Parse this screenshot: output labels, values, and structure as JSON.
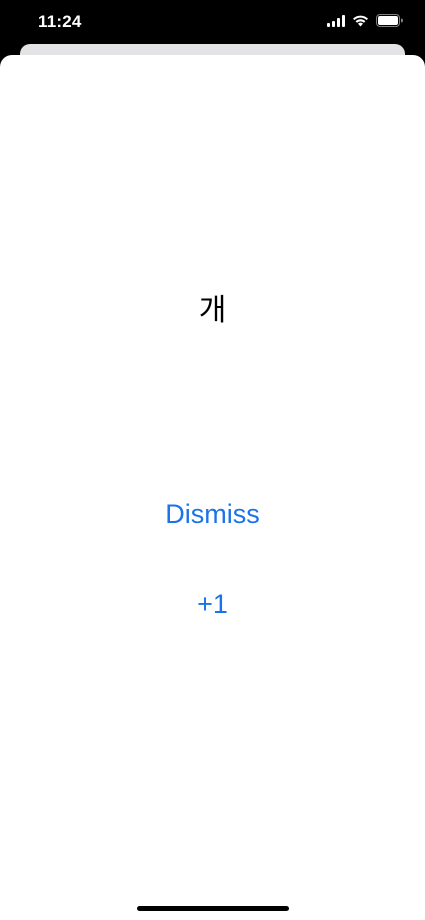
{
  "status_bar": {
    "time": "11:24",
    "icons": [
      "cellular-signal-icon",
      "wifi-icon",
      "battery-icon"
    ]
  },
  "sheet": {
    "word": "개",
    "dismiss_label": "Dismiss",
    "plus_one_label": "+1"
  },
  "colors": {
    "accent": "#1a73e8",
    "text": "#000000",
    "sheet_background": "#ffffff",
    "status_bar_background": "#000000"
  }
}
